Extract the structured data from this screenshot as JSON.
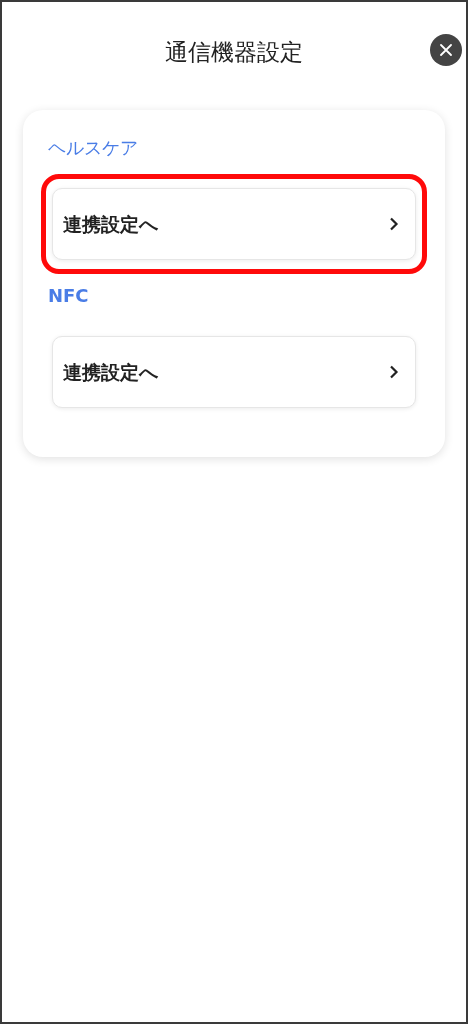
{
  "title": "通信機器設定",
  "sections": [
    {
      "label": "ヘルスケア",
      "items": [
        {
          "label": "連携設定へ",
          "highlighted": true
        }
      ]
    },
    {
      "label": "NFC",
      "items": [
        {
          "label": "連携設定へ",
          "highlighted": false
        }
      ]
    }
  ]
}
